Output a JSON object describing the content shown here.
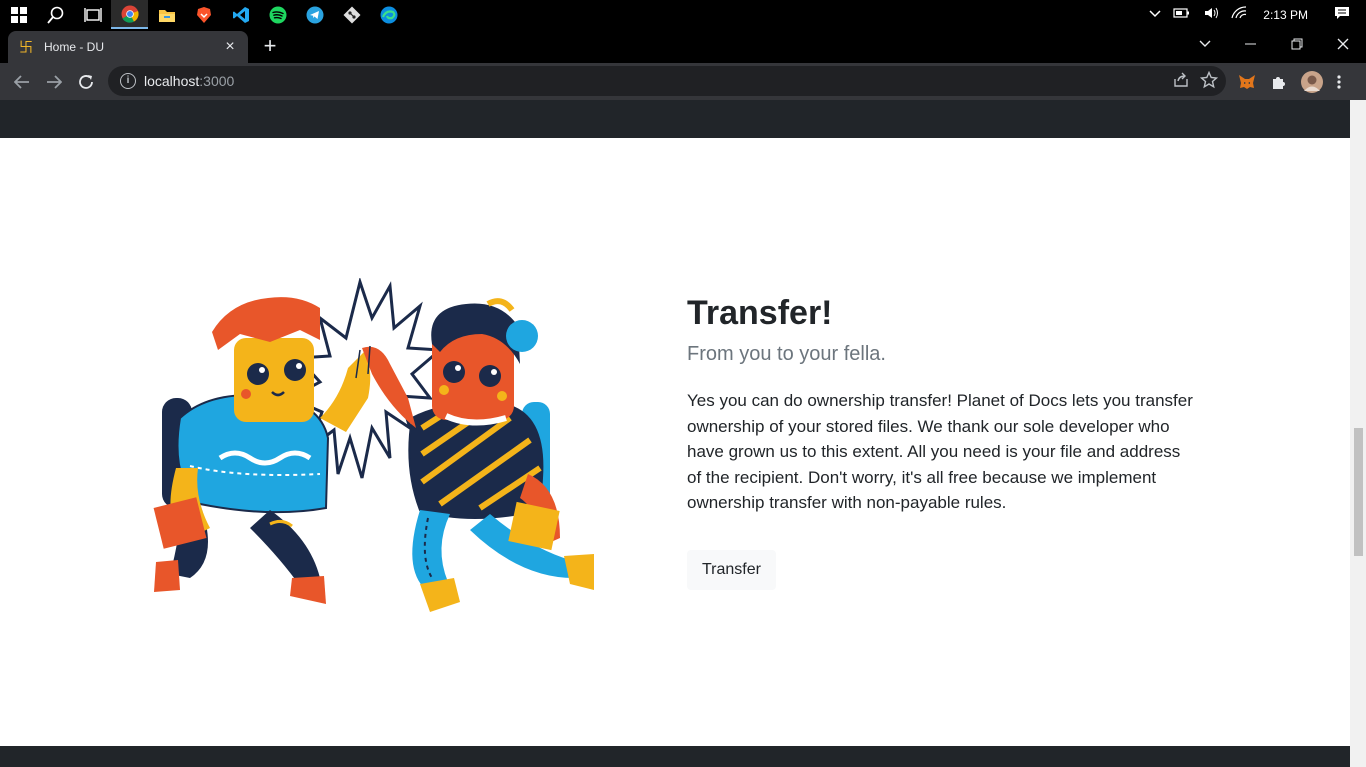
{
  "taskbar": {
    "icons": [
      "windows-start-icon",
      "search-icon",
      "task-view-icon",
      "chrome-icon",
      "file-explorer-icon",
      "brave-icon",
      "vscode-icon",
      "spotify-icon",
      "telegram-icon",
      "git-icon",
      "edge-icon"
    ],
    "time": "2:13 PM"
  },
  "browser": {
    "tab_title": "Home - DU",
    "url_host": "localhost",
    "url_port": ":3000"
  },
  "page": {
    "headline": "Transfer!",
    "lead": "From you to your fella.",
    "body": "Yes you can do ownership transfer! Planet of Docs lets you transfer ownership of your stored files. We thank our sole developer who have grown us to this extent. All you need is your file and address of the recipient. Don't worry, it's all free because we implement ownership transfer with non-payable rules.",
    "button_label": "Transfer"
  },
  "colors": {
    "nav_bg": "#212529",
    "chrome_toolbar": "#35363a",
    "button_bg": "#f8f9fa"
  }
}
